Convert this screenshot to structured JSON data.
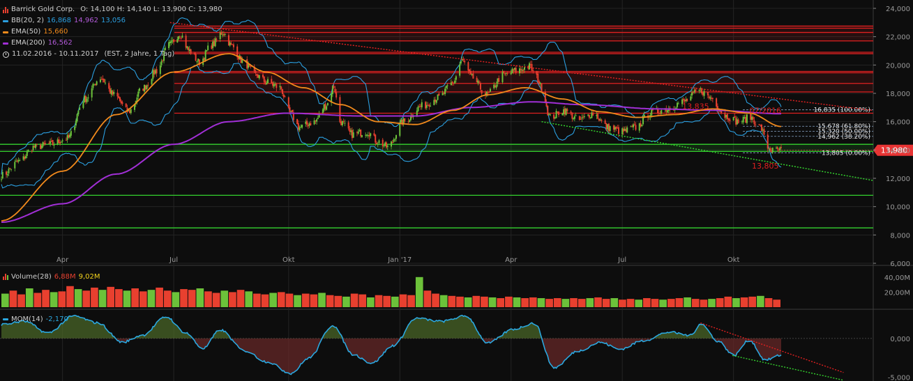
{
  "header": {
    "title": "Barrick Gold Corp.",
    "ohlc": "O: 14,100  H: 14,140  L: 13,900  C: 13,980"
  },
  "indicators": [
    {
      "name": "BB(20, 2)",
      "values": [
        "16,868",
        "14,962",
        "13,056"
      ],
      "colors": [
        "#2b9fe0",
        "#b25ad9",
        "#2b9fe0"
      ]
    },
    {
      "name": "EMA(50)",
      "values": [
        "15,660"
      ],
      "colors": [
        "#f28a1c"
      ]
    },
    {
      "name": "EMA(200)",
      "values": [
        "16,562"
      ],
      "colors": [
        "#a12fd6"
      ]
    }
  ],
  "date_range": "11.02.2016 - 10.11.2017",
  "date_meta": "(EST, 2 Jahre, 1 Tag)",
  "volume_legend": {
    "name": "Volume(28)",
    "v1": "6,88M",
    "v2": "9,02M"
  },
  "mom_legend": {
    "name": "MOM(14)",
    "value": "-2,170"
  },
  "colors": {
    "background": "#0d0d0d",
    "grid": "#242424",
    "up": "#6cc23a",
    "down": "#e8402f",
    "bb": "#2b9fe0",
    "ema50": "#f28a1c",
    "ema200": "#a12fd6",
    "resistance": "#e02020",
    "support": "#34d22e",
    "price_tag": "#e83434",
    "mom_line": "#2ba8e0"
  },
  "chart_data": {
    "type": "line",
    "x_ticks": [
      "Apr",
      "Jul",
      "Okt",
      "Jan '17",
      "Apr",
      "Jul",
      "Okt"
    ],
    "y_ticks": [
      "24,000",
      "22,000",
      "20,000",
      "18,000",
      "16,000",
      "14,000",
      "12,000",
      "10,000",
      "8,000",
      "6,000"
    ],
    "ylim": [
      6,
      24
    ],
    "last_price": 13.98,
    "last_price_label": "13,980",
    "annotations": [
      {
        "label": "13,835",
        "date": "2017-09-01",
        "value": 16.9
      },
      {
        "label": "07/2016",
        "date": "2017-10-28",
        "value": 16.6
      },
      {
        "label": "13,805",
        "date": "2017-10-28",
        "value": 12.7
      }
    ],
    "fib_levels": [
      {
        "label": "16,835 (100.00%)",
        "value": 16.835
      },
      {
        "label": "15,678 (61.80%)",
        "value": 15.678
      },
      {
        "label": "15,320 (50.00%)",
        "value": 15.32
      },
      {
        "label": "14,962 (38.20%)",
        "value": 14.962
      },
      {
        "label": "13,805 (0.00%)",
        "value": 13.805
      }
    ],
    "resistance_levels": [
      22.75,
      22.6,
      22.3,
      21.7,
      20.9,
      20.8,
      19.55,
      19.45,
      18.7,
      18.1,
      16.6
    ],
    "support_levels": [
      14.4,
      13.9,
      10.8,
      8.5
    ],
    "trendlines": [
      {
        "style": "dotted",
        "color": "#e02020",
        "points": [
          [
            "2016-06-28",
            23.0
          ],
          [
            "2017-11-10",
            17.6
          ]
        ]
      },
      {
        "style": "dotted",
        "color": "#34d22e",
        "points": [
          [
            "2017-04-28",
            16.0
          ],
          [
            "2017-11-10",
            13.0
          ]
        ]
      }
    ],
    "price_anchor_points": [
      [
        "2016-02-11",
        12.2
      ],
      [
        "2016-02-26",
        13.2
      ],
      [
        "2016-03-08",
        14.2
      ],
      [
        "2016-03-22",
        14.4
      ],
      [
        "2016-04-05",
        14.8
      ],
      [
        "2016-04-19",
        17.6
      ],
      [
        "2016-05-02",
        19.1
      ],
      [
        "2016-05-13",
        17.9
      ],
      [
        "2016-05-25",
        16.7
      ],
      [
        "2016-06-06",
        18.4
      ],
      [
        "2016-06-17",
        19.6
      ],
      [
        "2016-06-27",
        21.4
      ],
      [
        "2016-07-06",
        22.2
      ],
      [
        "2016-07-14",
        21.0
      ],
      [
        "2016-07-22",
        20.2
      ],
      [
        "2016-08-01",
        21.4
      ],
      [
        "2016-08-10",
        22.3
      ],
      [
        "2016-08-18",
        21.3
      ],
      [
        "2016-08-26",
        20.3
      ],
      [
        "2016-09-06",
        19.3
      ],
      [
        "2016-09-15",
        18.8
      ],
      [
        "2016-09-26",
        18.4
      ],
      [
        "2016-10-04",
        16.6
      ],
      [
        "2016-10-12",
        15.6
      ],
      [
        "2016-10-24",
        16.0
      ],
      [
        "2016-11-03",
        17.2
      ],
      [
        "2016-11-09",
        18.5
      ],
      [
        "2016-11-14",
        16.0
      ],
      [
        "2016-11-24",
        15.1
      ],
      [
        "2016-12-06",
        15.3
      ],
      [
        "2016-12-15",
        14.6
      ],
      [
        "2016-12-23",
        14.2
      ],
      [
        "2017-01-05",
        16.0
      ],
      [
        "2017-01-20",
        17.1
      ],
      [
        "2017-02-03",
        17.7
      ],
      [
        "2017-02-14",
        18.7
      ],
      [
        "2017-02-22",
        20.3
      ],
      [
        "2017-03-02",
        19.1
      ],
      [
        "2017-03-14",
        17.9
      ],
      [
        "2017-03-28",
        19.3
      ],
      [
        "2017-04-07",
        19.6
      ],
      [
        "2017-04-18",
        19.9
      ],
      [
        "2017-04-24",
        19.1
      ],
      [
        "2017-04-28",
        18.4
      ],
      [
        "2017-05-05",
        16.3
      ],
      [
        "2017-05-16",
        16.8
      ],
      [
        "2017-05-29",
        16.1
      ],
      [
        "2017-06-09",
        16.6
      ],
      [
        "2017-06-21",
        15.6
      ],
      [
        "2017-07-03",
        15.3
      ],
      [
        "2017-07-14",
        15.6
      ],
      [
        "2017-07-26",
        16.6
      ],
      [
        "2017-08-08",
        16.9
      ],
      [
        "2017-08-22",
        17.4
      ],
      [
        "2017-09-05",
        18.2
      ],
      [
        "2017-09-13",
        17.7
      ],
      [
        "2017-09-26",
        16.4
      ],
      [
        "2017-10-06",
        16.0
      ],
      [
        "2017-10-16",
        16.3
      ],
      [
        "2017-10-24",
        15.6
      ],
      [
        "2017-10-30",
        14.2
      ],
      [
        "2017-11-03",
        13.95
      ],
      [
        "2017-11-10",
        13.98
      ]
    ],
    "ema50_anchor_points": [
      [
        "2016-02-11",
        9.0
      ],
      [
        "2016-04-01",
        12.5
      ],
      [
        "2016-05-15",
        16.5
      ],
      [
        "2016-07-01",
        19.5
      ],
      [
        "2016-08-15",
        20.8
      ],
      [
        "2016-09-15",
        19.5
      ],
      [
        "2016-10-15",
        18.4
      ],
      [
        "2016-11-15",
        17.2
      ],
      [
        "2016-12-15",
        16.0
      ],
      [
        "2017-01-15",
        15.8
      ],
      [
        "2017-02-15",
        16.8
      ],
      [
        "2017-03-15",
        17.9
      ],
      [
        "2017-04-15",
        18.4
      ],
      [
        "2017-05-15",
        17.6
      ],
      [
        "2017-06-15",
        16.7
      ],
      [
        "2017-07-15",
        16.3
      ],
      [
        "2017-08-15",
        16.5
      ],
      [
        "2017-09-15",
        16.9
      ],
      [
        "2017-10-15",
        16.6
      ],
      [
        "2017-11-10",
        15.66
      ]
    ],
    "ema200_anchor_points": [
      [
        "2016-02-11",
        8.9
      ],
      [
        "2016-04-01",
        10.2
      ],
      [
        "2016-05-15",
        12.3
      ],
      [
        "2016-07-01",
        14.4
      ],
      [
        "2016-08-15",
        16.0
      ],
      [
        "2016-10-01",
        16.6
      ],
      [
        "2016-12-01",
        16.4
      ],
      [
        "2017-01-15",
        16.4
      ],
      [
        "2017-03-01",
        17.0
      ],
      [
        "2017-04-20",
        17.4
      ],
      [
        "2017-06-01",
        17.2
      ],
      [
        "2017-08-01",
        16.9
      ],
      [
        "2017-09-15",
        16.8
      ],
      [
        "2017-11-10",
        16.56
      ]
    ],
    "volume": {
      "y_ticks": [
        "40,00M",
        "20,00M"
      ],
      "ylim": [
        0,
        50
      ],
      "values_m": [
        18,
        22,
        17,
        25,
        19,
        23,
        20,
        21,
        28,
        24,
        22,
        26,
        23,
        27,
        24,
        22,
        25,
        21,
        23,
        26,
        22,
        20,
        24,
        23,
        25,
        21,
        19,
        22,
        20,
        23,
        21,
        18,
        17,
        19,
        20,
        18,
        16,
        18,
        17,
        19,
        16,
        15,
        14,
        18,
        17,
        13,
        16,
        15,
        14,
        17,
        16,
        40,
        22,
        18,
        16,
        15,
        14,
        13,
        15,
        14,
        13,
        12,
        14,
        13,
        12,
        13,
        12,
        11,
        12,
        11,
        12,
        11,
        12,
        13,
        11,
        12,
        10,
        11,
        10,
        12,
        11,
        10,
        11,
        12,
        13,
        11,
        10,
        11,
        12,
        14,
        12,
        13,
        14,
        15,
        12,
        10
      ]
    },
    "momentum": {
      "y_ticks": [
        "0,000",
        "-5,000"
      ],
      "ylim": [
        -5.5,
        3.5
      ],
      "anchor_points": [
        [
          "2016-02-11",
          1.8
        ],
        [
          "2016-03-01",
          2.2
        ],
        [
          "2016-03-20",
          0.7
        ],
        [
          "2016-04-10",
          2.9
        ],
        [
          "2016-04-30",
          2.0
        ],
        [
          "2016-05-20",
          -0.5
        ],
        [
          "2016-06-05",
          0.4
        ],
        [
          "2016-06-25",
          2.8
        ],
        [
          "2016-07-10",
          0.8
        ],
        [
          "2016-07-25",
          -1.3
        ],
        [
          "2016-08-08",
          1.1
        ],
        [
          "2016-08-28",
          -1.6
        ],
        [
          "2016-09-15",
          -3.0
        ],
        [
          "2016-10-05",
          -4.5
        ],
        [
          "2016-10-20",
          -2.5
        ],
        [
          "2016-11-08",
          1.7
        ],
        [
          "2016-11-25",
          -2.1
        ],
        [
          "2016-12-10",
          -3.2
        ],
        [
          "2016-12-28",
          -0.9
        ],
        [
          "2017-01-15",
          2.6
        ],
        [
          "2017-02-05",
          2.2
        ],
        [
          "2017-02-25",
          2.9
        ],
        [
          "2017-03-15",
          -0.6
        ],
        [
          "2017-04-05",
          1.2
        ],
        [
          "2017-04-22",
          2.0
        ],
        [
          "2017-05-08",
          -3.8
        ],
        [
          "2017-05-28",
          -1.6
        ],
        [
          "2017-06-15",
          -0.5
        ],
        [
          "2017-07-01",
          -1.4
        ],
        [
          "2017-07-20",
          -0.3
        ],
        [
          "2017-08-10",
          0.8
        ],
        [
          "2017-08-28",
          0.4
        ],
        [
          "2017-09-05",
          1.9
        ],
        [
          "2017-09-20",
          -0.4
        ],
        [
          "2017-10-02",
          -2.2
        ],
        [
          "2017-10-15",
          -0.2
        ],
        [
          "2017-10-28",
          -2.8
        ],
        [
          "2017-11-10",
          -2.17
        ]
      ],
      "trendlines": [
        {
          "style": "dotted",
          "color": "#e02020",
          "points": [
            [
              "2017-09-05",
              2.0
            ],
            [
              "2017-12-31",
              -4.4
            ]
          ]
        },
        {
          "style": "dotted",
          "color": "#34d22e",
          "points": [
            [
              "2017-10-01",
              -2.2
            ],
            [
              "2017-12-31",
              -5.4
            ]
          ]
        }
      ]
    }
  }
}
